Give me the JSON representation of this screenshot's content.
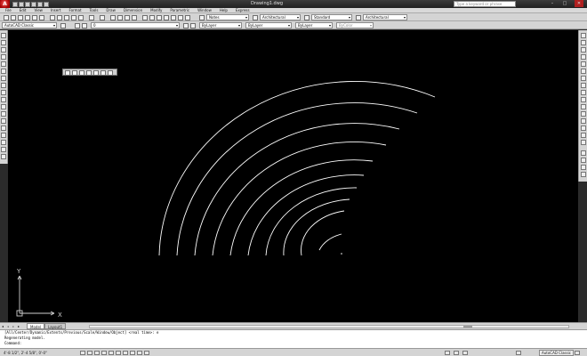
{
  "titlebar": {
    "app_letter": "A",
    "title": "Drawing1.dwg",
    "search_placeholder": "Type a keyword or phrase",
    "minimize": "–",
    "maximize": "□",
    "close": "✕"
  },
  "menu": [
    "File",
    "Edit",
    "View",
    "Insert",
    "Format",
    "Tools",
    "Draw",
    "Dimension",
    "Modify",
    "Parametric",
    "Window",
    "Help",
    "Express"
  ],
  "toolbar1": {
    "text_style": "Notes",
    "dim_style": "Architectural",
    "table_style": "Standard",
    "mleader_style": "Architectural"
  },
  "toolbar2": {
    "workspace": "AutoCAD Classic",
    "layer": "0",
    "color": "ByLayer",
    "linetype": "ByLayer",
    "lineweight": "ByLayer",
    "plotstyle": "ByColor"
  },
  "ucs": {
    "y_label": "Y",
    "x_label": "X"
  },
  "tabs": {
    "model": "Model",
    "layout1": "Layout1"
  },
  "command": {
    "line1": "[All/Center/Dynamic/Extents/Previous/Scale/Window/Object] <real time>: e",
    "line2": "Regenerating model.",
    "line3": "Command:"
  },
  "status": {
    "coords": "4'-8 1/2\", 2'-4 5/8\", 0'-0\"",
    "workspace": "AutoCAD Classic"
  },
  "colors": {
    "canvas": "#000000",
    "arcs": "#ffffff",
    "app_red": "#c40000"
  }
}
